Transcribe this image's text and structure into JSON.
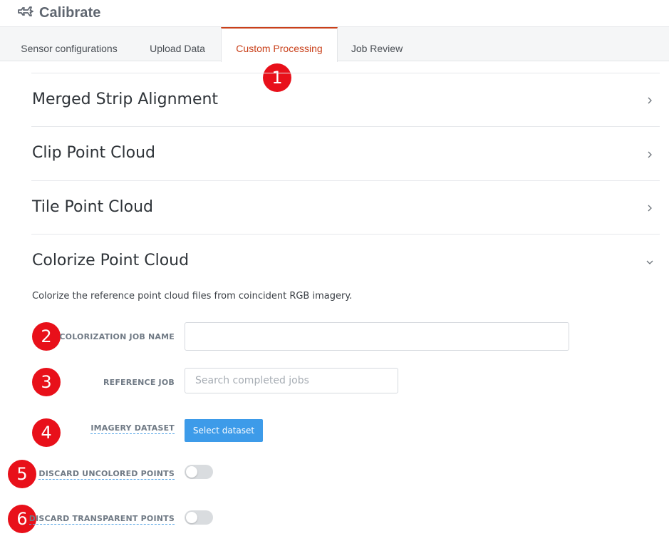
{
  "app": {
    "title": "Calibrate",
    "logo_icon": "airplane-icon"
  },
  "tabs": [
    {
      "label": "Sensor configurations",
      "active": false
    },
    {
      "label": "Upload Data",
      "active": false
    },
    {
      "label": "Custom Processing",
      "active": true
    },
    {
      "label": "Job Review",
      "active": false
    }
  ],
  "sections": [
    {
      "title": "Merged Strip Alignment",
      "expanded": false,
      "icon": "chevron-right-icon"
    },
    {
      "title": "Clip Point Cloud",
      "expanded": false,
      "icon": "chevron-right-icon"
    },
    {
      "title": "Tile Point Cloud",
      "expanded": false,
      "icon": "chevron-right-icon"
    },
    {
      "title": "Colorize Point Cloud",
      "expanded": true,
      "icon": "chevron-down-icon"
    }
  ],
  "colorize": {
    "description": "Colorize the reference point cloud files from coincident RGB imagery.",
    "job_name_label": "COLORIZATION JOB NAME",
    "job_name_value": "",
    "reference_job_label": "REFERENCE JOB",
    "reference_job_placeholder": "Search completed jobs",
    "imagery_dataset_label": "IMAGERY DATASET",
    "select_dataset_button": "Select dataset",
    "discard_uncolored_label": "DISCARD UNCOLORED POINTS",
    "discard_uncolored_on": false,
    "discard_transparent_label": "DISCARD TRANSPARENT POINTS",
    "discard_transparent_on": false
  },
  "markers": [
    "1",
    "2",
    "3",
    "4",
    "5",
    "6"
  ],
  "colors": {
    "accent_active_tab": "#c9401a",
    "primary_button": "#3d9be9",
    "marker": "#e8101a"
  }
}
